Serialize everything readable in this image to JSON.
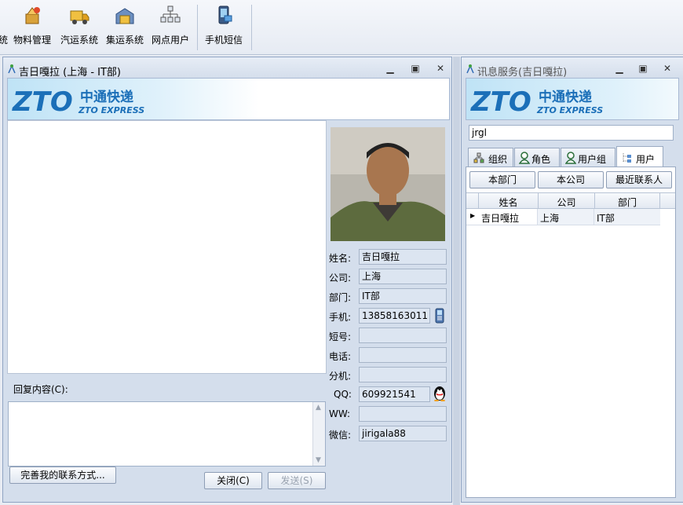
{
  "toolbar": {
    "partial_label": "统",
    "items": [
      {
        "label": "物料管理",
        "icon": "materials-icon"
      },
      {
        "label": "汽运系统",
        "icon": "truck-icon"
      },
      {
        "label": "集运系统",
        "icon": "warehouse-icon"
      },
      {
        "label": "网点用户",
        "icon": "network-icon"
      },
      {
        "label": "手机短信",
        "icon": "mobile-sms-icon"
      }
    ]
  },
  "chat_window": {
    "title": "吉日嘎拉 (上海 - IT部)",
    "reply_label": "回复内容(C):",
    "reply_value": "",
    "complete_contact_label": "完善我的联系方式...",
    "close_label": "关闭(C)",
    "send_label": "发送(S)",
    "profile": {
      "name_label": "姓名:",
      "name": "吉日嘎拉",
      "company_label": "公司:",
      "company": "上海",
      "dept_label": "部门:",
      "dept": "IT部",
      "mobile_label": "手机:",
      "mobile": "13858163011",
      "short_label": "短号:",
      "short": "",
      "phone_label": "电话:",
      "phone": "",
      "ext_label": "分机:",
      "ext": "",
      "qq_label": "QQ:",
      "qq": "609921541",
      "ww_label": "WW:",
      "ww": "",
      "wechat_label": "微信:",
      "wechat": "jirigala88"
    }
  },
  "logo": {
    "brand_cn": "中通快递",
    "brand_en": "ZTO EXPRESS"
  },
  "im_window": {
    "title": "讯息服务(吉日嘎拉)",
    "search_value": "jrgl",
    "tabs": [
      {
        "label": "组织",
        "icon": "organization-icon"
      },
      {
        "label": "角色",
        "icon": "role-icon"
      },
      {
        "label": "用户组",
        "icon": "user-group-icon"
      },
      {
        "label": "用户",
        "icon": "user-tree-icon"
      }
    ],
    "filter_buttons": [
      "本部门",
      "本公司",
      "最近联系人"
    ],
    "columns": [
      "姓名",
      "公司",
      "部门"
    ],
    "rows": [
      [
        "吉日嘎拉",
        "上海",
        "IT部"
      ]
    ]
  },
  "colors": {
    "brand_blue": "#1b6fb8",
    "title_bg": "#d3ddeb"
  }
}
